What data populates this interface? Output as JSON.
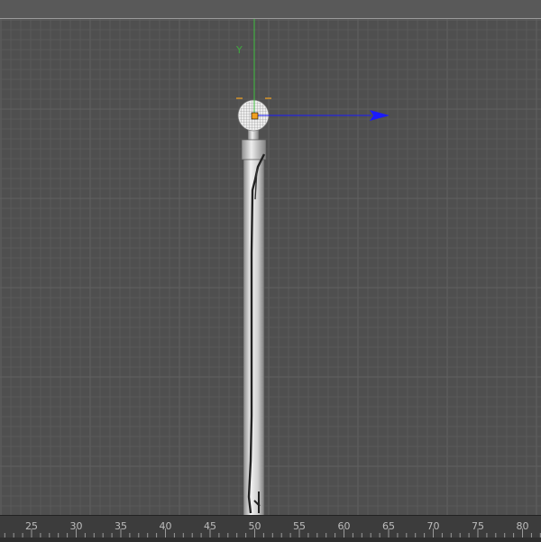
{
  "viewport": {
    "axis_y_label": "Y",
    "colors": {
      "background": "#4f4f4f",
      "grid": "#5a5a5a",
      "y_axis": "#3fbf3f",
      "x_axis": "#1a1aff",
      "selection": "#f0a020"
    },
    "icons": [
      "sphere-light-icon",
      "move-gizmo-icon"
    ]
  },
  "ruler": {
    "labels": [
      "25",
      "30",
      "35",
      "40",
      "45",
      "50",
      "55",
      "60",
      "65",
      "70",
      "75",
      "80"
    ]
  }
}
